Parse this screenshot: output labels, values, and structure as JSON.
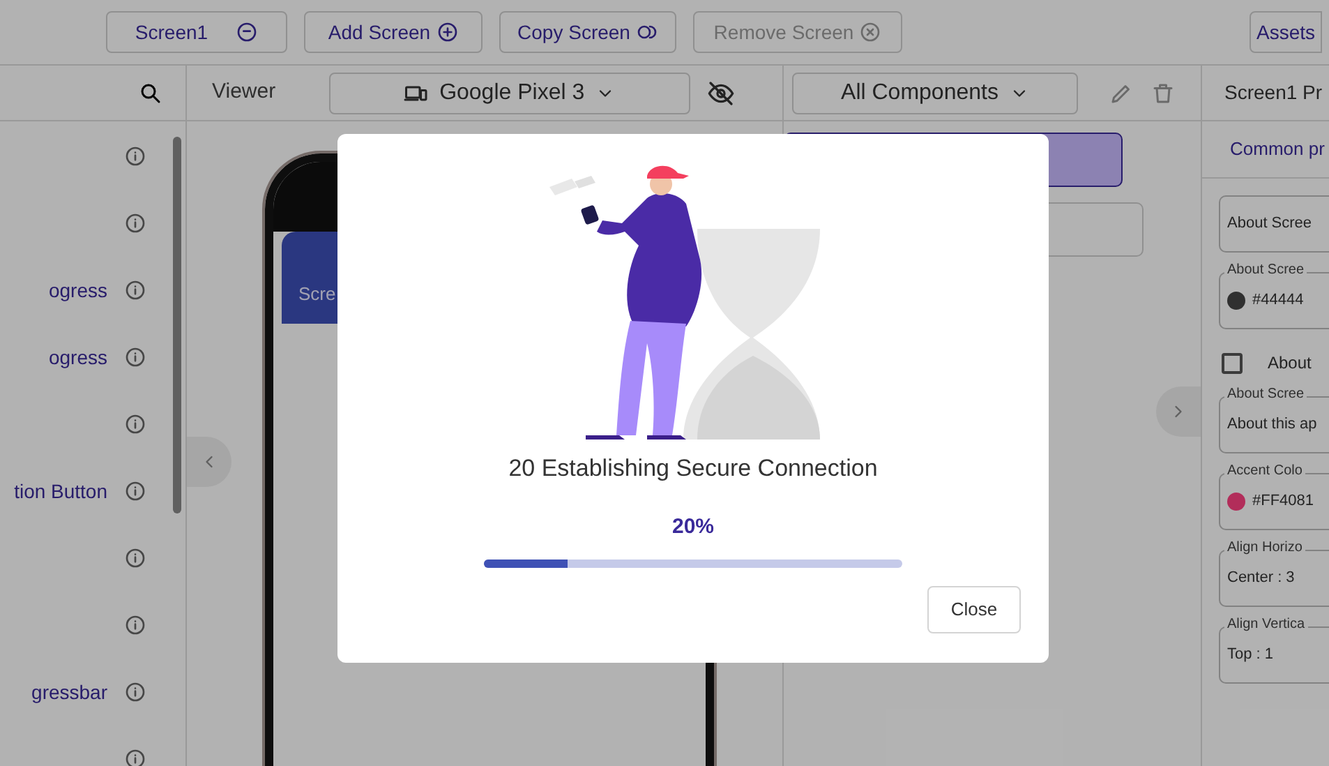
{
  "toolbar": {
    "buttons": [
      {
        "label": "Screen1",
        "disabled": false
      },
      {
        "label": "Add Screen",
        "disabled": false
      },
      {
        "label": "Copy Screen",
        "disabled": false
      },
      {
        "label": "Remove Screen",
        "disabled": true
      },
      {
        "label": "Assets",
        "disabled": false
      }
    ]
  },
  "palette": {
    "items": [
      {
        "kind": "icon-only"
      },
      {
        "kind": "icon-only"
      },
      {
        "kind": "labeled",
        "label": "ogress"
      },
      {
        "kind": "labeled",
        "label": "ogress"
      },
      {
        "kind": "icon-only"
      },
      {
        "kind": "labeled",
        "label": "tion Button"
      },
      {
        "kind": "icon-only"
      },
      {
        "kind": "icon-only"
      },
      {
        "kind": "labeled",
        "label": "gressbar"
      },
      {
        "kind": "icon-only"
      }
    ]
  },
  "viewer": {
    "title": "Viewer",
    "device": "Google Pixel 3",
    "app_bar_title": "Scre"
  },
  "components": {
    "filter": "All Components",
    "items": [
      {
        "selected": true
      },
      {
        "selected": false
      }
    ]
  },
  "properties": {
    "title": "Screen1 Pr",
    "tab": "Common pr",
    "fields": [
      {
        "kind": "text",
        "value": "About Scree"
      },
      {
        "kind": "color",
        "label": "About Scree",
        "value": "#44444",
        "color": "#303030"
      },
      {
        "kind": "checkbox",
        "label": "About",
        "checked": false
      },
      {
        "kind": "text",
        "label": "About Scree",
        "value": "About this ap"
      },
      {
        "kind": "color",
        "label": "Accent Colo",
        "value": "#FF4081",
        "color": "#b22d5a"
      },
      {
        "kind": "select",
        "label": "Align Horizo",
        "value": "Center : 3"
      },
      {
        "kind": "select",
        "label": "Align Vertica",
        "value": "Top : 1"
      }
    ]
  },
  "dialog": {
    "message": "20 Establishing Secure Connection",
    "percent": "20%",
    "progress": {
      "level": 0.2
    },
    "close_button": "Close"
  }
}
